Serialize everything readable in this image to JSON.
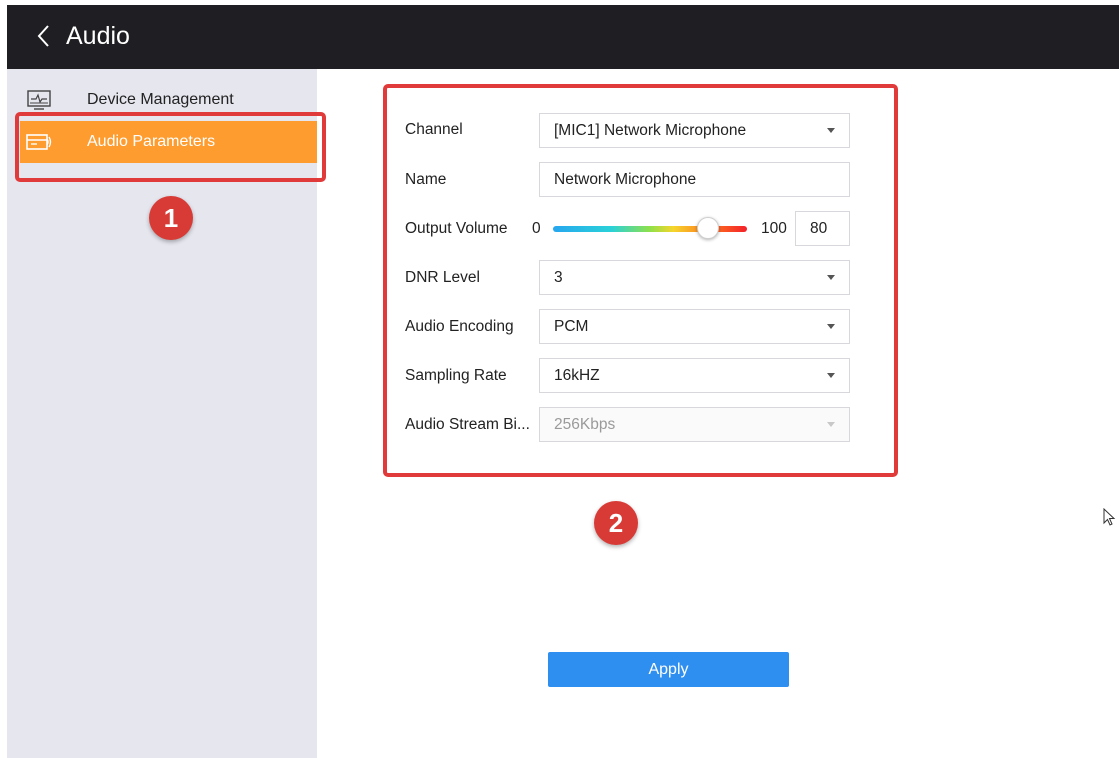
{
  "header": {
    "title": "Audio"
  },
  "sidebar": {
    "items": [
      {
        "label": "Device Management",
        "icon": "device-management-icon",
        "active": false
      },
      {
        "label": "Audio Parameters",
        "icon": "audio-parameters-icon",
        "active": true
      }
    ]
  },
  "annotations": {
    "badge1": "1",
    "badge2": "2",
    "color": "#e03a3a"
  },
  "form": {
    "channel": {
      "label": "Channel",
      "value": "[MIC1] Network Microphone"
    },
    "name": {
      "label": "Name",
      "value": "Network Microphone"
    },
    "output_volume": {
      "label": "Output Volume",
      "min": "0",
      "max": "100",
      "value": "80"
    },
    "dnr_level": {
      "label": "DNR Level",
      "value": "3"
    },
    "audio_encoding": {
      "label": "Audio Encoding",
      "value": "PCM"
    },
    "sampling_rate": {
      "label": "Sampling Rate",
      "value": "16kHZ"
    },
    "audio_stream_bitrate": {
      "label": "Audio Stream Bi...",
      "value": "256Kbps",
      "disabled": true
    }
  },
  "apply_label": "Apply",
  "colors": {
    "header_bg": "#1f1f23",
    "sidebar_bg": "#e6e6ef",
    "active_item": "#ff9c30",
    "primary": "#2f8ff0"
  }
}
